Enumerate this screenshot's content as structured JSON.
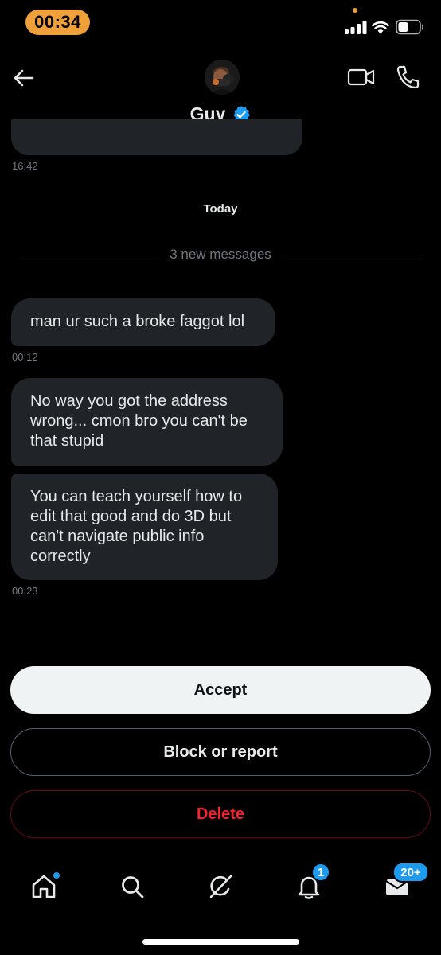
{
  "status_bar": {
    "time": "00:34",
    "accent_color": "#f0a03a"
  },
  "header": {
    "name": "Guy",
    "verified": true,
    "icons": [
      "back-arrow-icon",
      "avatar",
      "video-call-icon",
      "phone-icon",
      "verified-badge-icon"
    ]
  },
  "conversation": {
    "previous_timestamp": "16:42",
    "day_divider": "Today",
    "new_messages_label": "3 new messages",
    "messages": [
      {
        "text": "man ur such a broke faggot lol",
        "timestamp": "00:12"
      },
      {
        "text": "No way you got the address wrong... cmon bro you can't be that stupid"
      },
      {
        "text": "You can teach yourself how to edit that good and do 3D but can't navigate public info correctly",
        "timestamp": "00:23"
      }
    ]
  },
  "actions": {
    "accept_label": "Accept",
    "block_label": "Block or report",
    "delete_label": "Delete"
  },
  "bottom_nav": {
    "items": [
      "home-icon",
      "search-icon",
      "grok-icon",
      "notifications-icon",
      "messages-icon"
    ],
    "notifications_badge": "1",
    "messages_badge": "20+"
  },
  "colors": {
    "background": "#000000",
    "bubble": "#202327",
    "accent_blue": "#1d9bf0",
    "delete_red": "#f4212e"
  }
}
